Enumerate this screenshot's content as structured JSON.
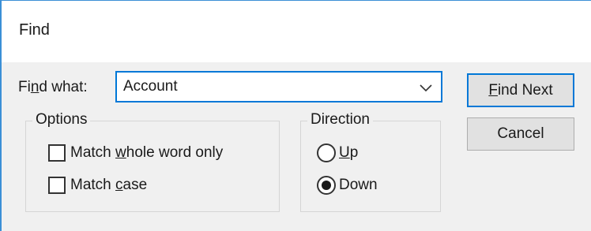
{
  "dialog": {
    "title": "Find"
  },
  "find_what": {
    "label_prefix": "Fi",
    "label_mnemonic": "n",
    "label_suffix": "d what:",
    "value": "Account"
  },
  "options": {
    "legend": "Options",
    "match_whole_word": {
      "prefix": "Match ",
      "mnemonic": "w",
      "suffix": "hole word only",
      "checked": false
    },
    "match_case": {
      "prefix": "Match ",
      "mnemonic": "c",
      "suffix": "ase",
      "checked": false
    }
  },
  "direction": {
    "legend": "Direction",
    "up": {
      "mnemonic": "U",
      "suffix": "p",
      "selected": false
    },
    "down": {
      "label": "Down",
      "selected": true
    }
  },
  "buttons": {
    "find_next": {
      "mnemonic": "F",
      "suffix": "ind Next"
    },
    "cancel": {
      "label": "Cancel"
    }
  },
  "colors": {
    "accent": "#0078d7",
    "frame": "#3b8fd6",
    "client_bg": "#f0f0f0",
    "button_bg": "#e1e1e1"
  },
  "icons": {
    "combo_arrow": "chevron-down-icon"
  }
}
